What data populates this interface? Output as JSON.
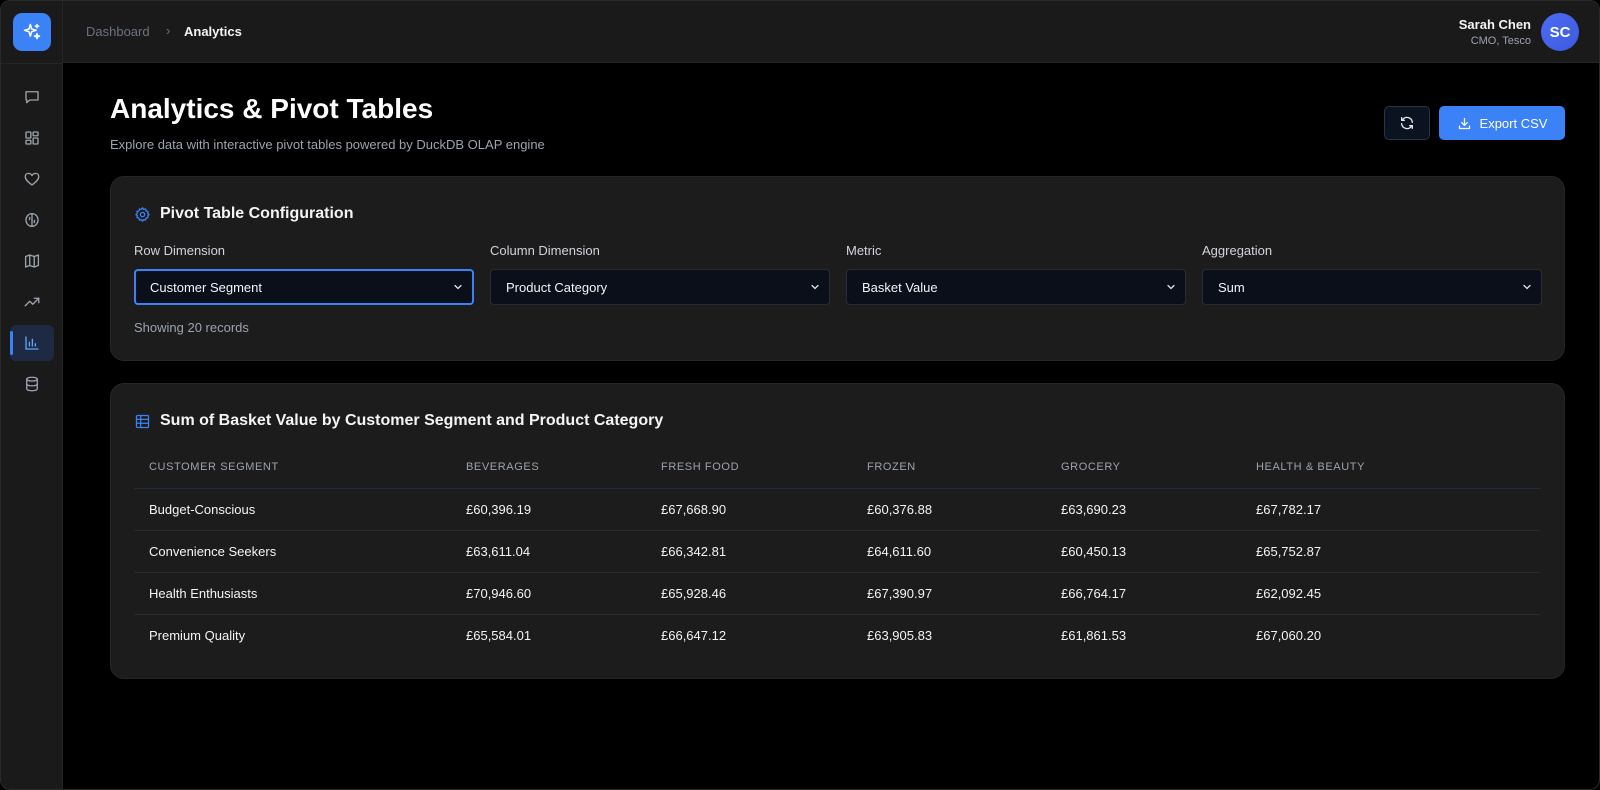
{
  "breadcrumb": {
    "root": "Dashboard",
    "separator": "›",
    "current": "Analytics"
  },
  "user": {
    "name": "Sarah Chen",
    "role": "CMO, Tesco",
    "initials": "SC"
  },
  "sidebar": {
    "items": [
      {
        "icon": "chat-icon"
      },
      {
        "icon": "dashboard-icon"
      },
      {
        "icon": "heart-icon"
      },
      {
        "icon": "brain-icon"
      },
      {
        "icon": "map-icon"
      },
      {
        "icon": "trending-up-icon"
      },
      {
        "icon": "bar-chart-icon",
        "active": true
      },
      {
        "icon": "database-icon"
      }
    ]
  },
  "header": {
    "title": "Analytics & Pivot Tables",
    "subtitle": "Explore data with interactive pivot tables powered by DuckDB OLAP engine",
    "export_label": "Export CSV"
  },
  "config": {
    "title": "Pivot Table Configuration",
    "row_dimension": {
      "label": "Row Dimension",
      "value": "Customer Segment"
    },
    "column_dimension": {
      "label": "Column Dimension",
      "value": "Product Category"
    },
    "metric": {
      "label": "Metric",
      "value": "Basket Value"
    },
    "aggregation": {
      "label": "Aggregation",
      "value": "Sum"
    },
    "records": "Showing 20 records"
  },
  "pivot": {
    "title": "Sum of Basket Value by Customer Segment and Product Category",
    "columns": [
      "CUSTOMER SEGMENT",
      "BEVERAGES",
      "FRESH FOOD",
      "FROZEN",
      "GROCERY",
      "HEALTH & BEAUTY"
    ],
    "rows": [
      [
        "Budget-Conscious",
        "£60,396.19",
        "£67,668.90",
        "£60,376.88",
        "£63,690.23",
        "£67,782.17"
      ],
      [
        "Convenience Seekers",
        "£63,611.04",
        "£66,342.81",
        "£64,611.60",
        "£60,450.13",
        "£65,752.87"
      ],
      [
        "Health Enthusiasts",
        "£70,946.60",
        "£65,928.46",
        "£67,390.97",
        "£66,764.17",
        "£62,092.45"
      ],
      [
        "Premium Quality",
        "£65,584.01",
        "£66,647.12",
        "£63,905.83",
        "£61,861.53",
        "£67,060.20"
      ]
    ]
  },
  "colors": {
    "accent": "#3b82f6",
    "background": "#000000",
    "card": "#1c1c1c"
  }
}
